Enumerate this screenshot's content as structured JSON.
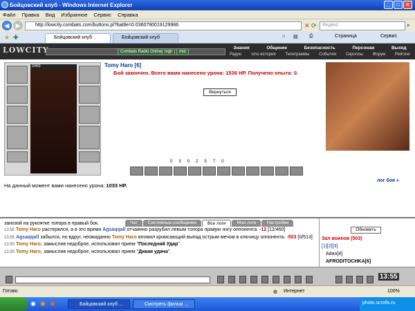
{
  "window": {
    "title": "Бойцовский клуб - Windows Internet Explorer"
  },
  "menu": [
    "Файл",
    "Правка",
    "Вид",
    "Избранное",
    "Сервис",
    "Справка"
  ],
  "address": {
    "url": "http://lowcity.combats.com/buttons.pl?battle=0.0360790019129986"
  },
  "search": {
    "placeholder": "Яндекс"
  },
  "tabs": [
    {
      "label": "Бойцовский клуб"
    },
    {
      "label": "Бойцовский клуб"
    }
  ],
  "toolbar": {
    "page": "Страница",
    "service": "Сервис"
  },
  "game": {
    "logo": "LOWCITY",
    "radio": "Combats Radio Online",
    "btn_high": "high",
    "btn_mid": "mid",
    "nav_top": [
      "Знания",
      "Общение",
      "Безопасность",
      "Персонаж",
      "Выход"
    ],
    "nav_bottom": [
      "Радио",
      "sms-история",
      "Телеграммы",
      "События",
      "Скроллы",
      "Форум",
      "Рейтинг"
    ]
  },
  "player": {
    "name": "Tomy Haro [6]",
    "hp": "0/460"
  },
  "battle": {
    "message": "Бой закончен. Всего вами нанесено урона: 1536 HP. Получено опыта: 0.",
    "back_label": "Вернуться",
    "stats": [
      "0",
      "3",
      "0",
      "2",
      "5",
      "7",
      "0"
    ],
    "damage_text": "На данный момент вами нанесено урона: ",
    "damage_value": "1033 HP.",
    "log_link": "лог боя »"
  },
  "chat": {
    "tabs": [
      "Чат",
      "Системные сообщения",
      "Все логи",
      "Мои логи",
      "Настройки"
    ],
    "lines": [
      {
        "time": "",
        "text": "занозой на рукоятке топора в правый бок."
      },
      {
        "time": "13:55",
        "actor": "Tomy Haro",
        "text": " растерялся, а в это время ",
        "actor2": "Agsaqqall",
        "text2": " отчаянно разрубил левым топора правую ногу оппонента. ",
        "dmg": "-12",
        "tail": " [12/460]"
      },
      {
        "time": "13:55",
        "actor2": "Agsaqqall",
        "text": " забылся, но вдруг, неожиданно ",
        "actor": "Tomy Haro",
        "text2": " вломил кромсающий выпад острым мечом в ключицу оппонента. ",
        "dmg": "-503",
        "tail": " [0/513]"
      },
      {
        "time": "13:55",
        "actor": "Tomy Haro",
        "text": ", замыслив недоброе, использовал прием \"",
        "bold": "Последний Удар",
        "tail": "\"."
      },
      {
        "time": "13:55",
        "actor": "Tomy Haro",
        "text": ", замыслив недоброе, использовал прием \"",
        "bold": "Дикая удача",
        "tail": "\"."
      }
    ]
  },
  "side": {
    "refresh": "Обновить",
    "hall": "Зал воинов (503)",
    "pages": "[1][2][3]",
    "users": [
      "Adan[4]",
      "AFRODITOCHKA[6]"
    ]
  },
  "clock": "13:55",
  "status": {
    "left": "Готово",
    "zone": "Интернет",
    "zoom": "100%"
  },
  "taskbar": {
    "tasks": [
      "Бойцовский клуб ...",
      "Смотреть фильм ..."
    ],
    "tray": "photo.scrolls.ru"
  }
}
